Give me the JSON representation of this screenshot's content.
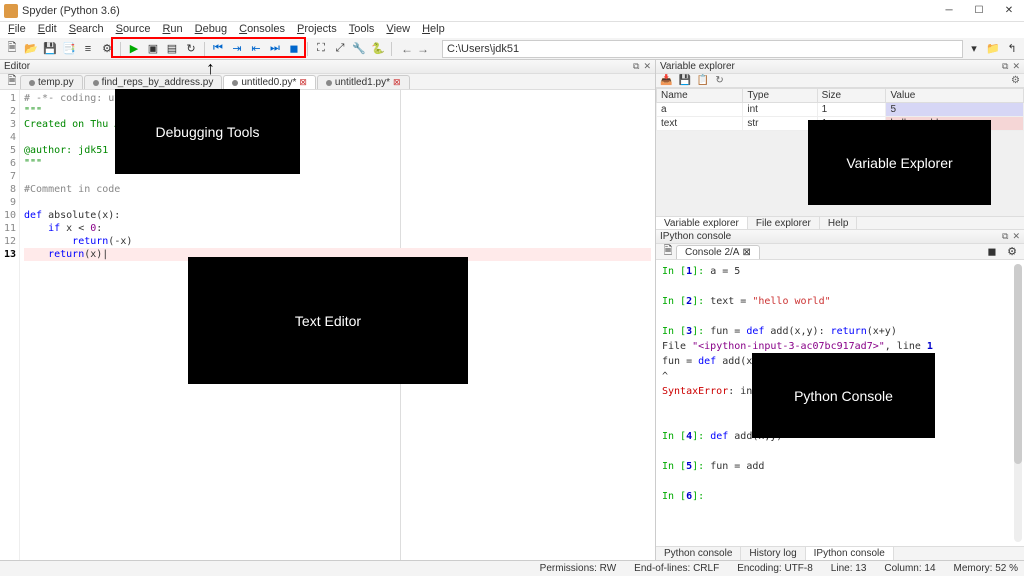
{
  "window": {
    "title": "Spyder (Python 3.6)"
  },
  "menu": [
    "File",
    "Edit",
    "Search",
    "Source",
    "Run",
    "Debug",
    "Consoles",
    "Projects",
    "Tools",
    "View",
    "Help"
  ],
  "path": "C:\\Users\\jdk51",
  "editor": {
    "pane_title": "Editor",
    "tabs": [
      {
        "label": "temp.py",
        "active": false,
        "close": false
      },
      {
        "label": "find_reps_by_address.py",
        "active": false,
        "close": false
      },
      {
        "label": "untitled0.py*",
        "active": true,
        "close": true
      },
      {
        "label": "untitled1.py*",
        "active": false,
        "close": true
      }
    ],
    "lines": [
      {
        "n": 1,
        "html": "<span class='c-comment'># -*- coding: utf-8 -</span>"
      },
      {
        "n": 2,
        "html": "<span class='c-str'>\"\"\"</span>"
      },
      {
        "n": 3,
        "html": "<span class='c-str'>Created on Thu Aug </span>"
      },
      {
        "n": 4,
        "html": ""
      },
      {
        "n": 5,
        "html": "<span class='c-str'>@author: jdk51</span>"
      },
      {
        "n": 6,
        "html": "<span class='c-str'>\"\"\"</span>"
      },
      {
        "n": 7,
        "html": ""
      },
      {
        "n": 8,
        "html": "<span class='c-comment'>#Comment in code</span>"
      },
      {
        "n": 9,
        "html": ""
      },
      {
        "n": 10,
        "html": "<span class='c-kw'>def</span> absolute(x):"
      },
      {
        "n": 11,
        "html": "    <span class='c-kw'>if</span> x &lt; <span class='c-builtin'>0</span>:"
      },
      {
        "n": 12,
        "html": "        <span class='c-kw'>return</span>(-x)"
      },
      {
        "n": 13,
        "html": "    <span class='c-kw'>return</span>(x)|",
        "current": true
      }
    ]
  },
  "varexplorer": {
    "pane_title": "Variable explorer",
    "cols": [
      "Name",
      "Type",
      "Size",
      "Value"
    ],
    "rows": [
      {
        "name": "a",
        "type": "int",
        "size": "1",
        "value": "5",
        "cls": "n5"
      },
      {
        "name": "text",
        "type": "str",
        "size": "1",
        "value": "hello world",
        "cls": "hw"
      }
    ],
    "subtabs": [
      "Variable explorer",
      "File explorer",
      "Help"
    ]
  },
  "ipython": {
    "pane_title": "IPython console",
    "tab": "Console 2/A",
    "lines": [
      "In [<b class='c-num'>1</b>]: a = 5",
      "",
      "In [<b class='c-num'>2</b>]: text = <span class='c-cstr'>\"hello world\"</span>",
      "",
      "In [<b class='c-num'>3</b>]: fun = <span class='c-blue'>def</span> add(x,y): <span class='c-blue'>return</span>(x+y)",
      "  File <span class='c-purple'>\"&lt;ipython-input-3-ac07bc917ad7&gt;\"</span>, line <span class='c-num'>1</span>",
      "    fun = <span class='c-blue'>def</span> add(x,",
      "          ^",
      "<span class='c-err'>SyntaxError</span>: invali",
      "",
      "",
      "In [<b class='c-num'>4</b>]: <span class='c-blue'>def</span> add(x,y)",
      "",
      "In [<b class='c-num'>5</b>]: fun = add",
      "",
      "In [<b class='c-num'>6</b>]: "
    ],
    "bottomtabs": [
      "Python console",
      "History log",
      "IPython console"
    ]
  },
  "status": {
    "perm": "Permissions: RW",
    "eol": "End-of-lines: CRLF",
    "enc": "Encoding: UTF-8",
    "line": "Line: 13",
    "col": "Column: 14",
    "mem": "Memory: 52 %"
  },
  "annotations": {
    "debug": "Debugging Tools",
    "editor": "Text Editor",
    "var": "Variable Explorer",
    "console": "Python Console"
  }
}
